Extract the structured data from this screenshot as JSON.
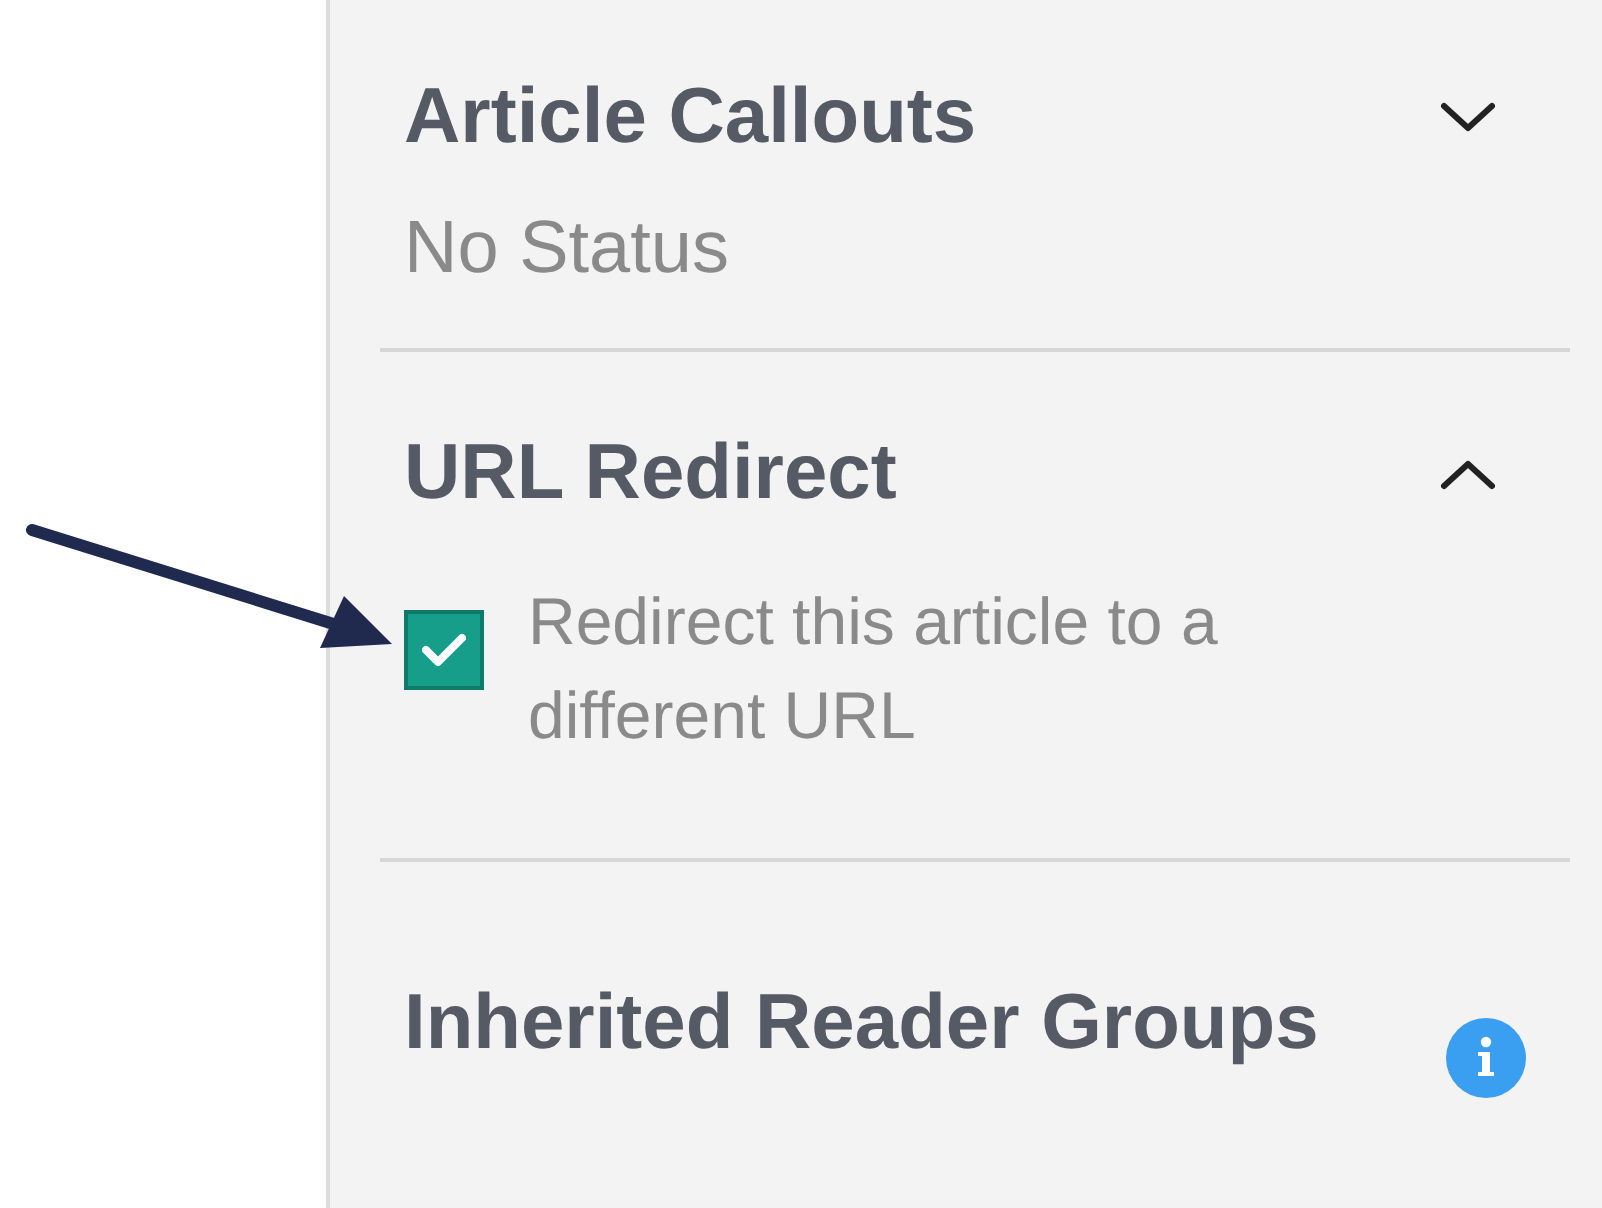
{
  "sections": [
    {
      "kind": "collapsible",
      "title": "Article Callouts",
      "expanded": false,
      "status": "No Status"
    },
    {
      "kind": "collapsible",
      "title": "URL Redirect",
      "expanded": true,
      "checkbox": {
        "label": "Redirect this article to a different URL",
        "checked": true
      }
    },
    {
      "kind": "info",
      "title": "Inherited Reader Groups"
    }
  ]
}
